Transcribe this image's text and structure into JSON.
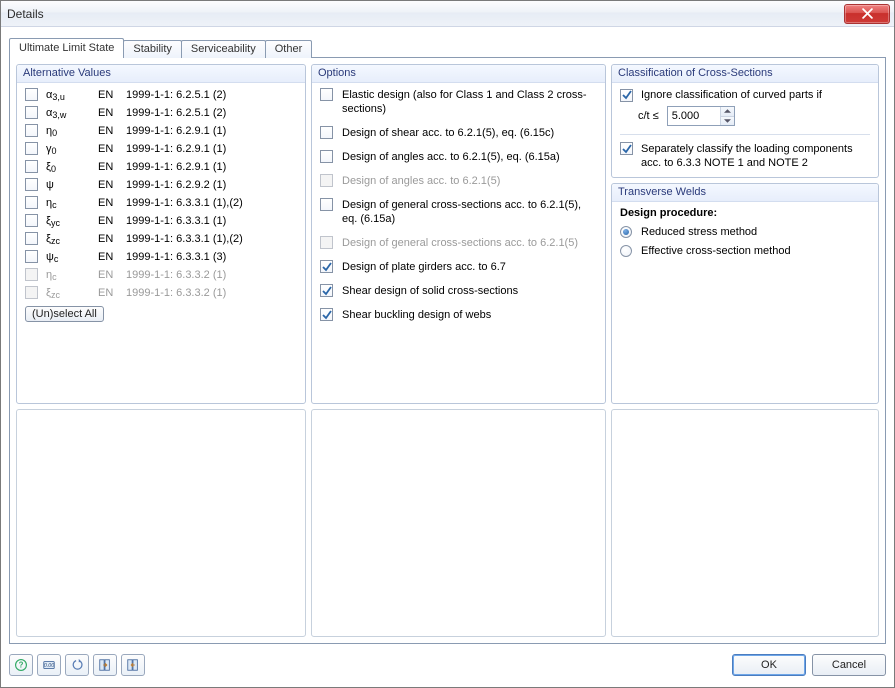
{
  "window": {
    "title": "Details"
  },
  "tabs": [
    "Ultimate Limit State",
    "Stability",
    "Serviceability",
    "Other"
  ],
  "active_tab": 0,
  "alt": {
    "title": "Alternative Values",
    "unselect": "(Un)select All",
    "rows": [
      {
        "checked": false,
        "enabled": true,
        "sym": "α",
        "sub": "3,u",
        "code": "EN",
        "ref": "1999-1-1: 6.2.5.1 (2)"
      },
      {
        "checked": false,
        "enabled": true,
        "sym": "α",
        "sub": "3,w",
        "code": "EN",
        "ref": "1999-1-1: 6.2.5.1 (2)"
      },
      {
        "checked": false,
        "enabled": true,
        "sym": "η",
        "sub": "0",
        "code": "EN",
        "ref": "1999-1-1: 6.2.9.1 (1)"
      },
      {
        "checked": false,
        "enabled": true,
        "sym": "γ",
        "sub": "0",
        "code": "EN",
        "ref": "1999-1-1: 6.2.9.1 (1)"
      },
      {
        "checked": false,
        "enabled": true,
        "sym": "ξ",
        "sub": "0",
        "code": "EN",
        "ref": "1999-1-1: 6.2.9.1 (1)"
      },
      {
        "checked": false,
        "enabled": true,
        "sym": "ψ",
        "sub": "",
        "code": "EN",
        "ref": "1999-1-1: 6.2.9.2 (1)"
      },
      {
        "checked": false,
        "enabled": true,
        "sym": "η",
        "sub": "c",
        "code": "EN",
        "ref": "1999-1-1: 6.3.3.1 (1),(2)"
      },
      {
        "checked": false,
        "enabled": true,
        "sym": "ξ",
        "sub": "yc",
        "code": "EN",
        "ref": "1999-1-1: 6.3.3.1 (1)"
      },
      {
        "checked": false,
        "enabled": true,
        "sym": "ξ",
        "sub": "zc",
        "code": "EN",
        "ref": "1999-1-1: 6.3.3.1 (1),(2)"
      },
      {
        "checked": false,
        "enabled": true,
        "sym": "ψ",
        "sub": "c",
        "code": "EN",
        "ref": "1999-1-1: 6.3.3.1 (3)"
      },
      {
        "checked": false,
        "enabled": false,
        "sym": "η",
        "sub": "c",
        "code": "EN",
        "ref": "1999-1-1: 6.3.3.2 (1)"
      },
      {
        "checked": false,
        "enabled": false,
        "sym": "ξ",
        "sub": "zc",
        "code": "EN",
        "ref": "1999-1-1: 6.3.3.2 (1)"
      }
    ]
  },
  "options": {
    "title": "Options",
    "items": [
      {
        "checked": false,
        "enabled": true,
        "label": "Elastic design (also for Class 1 and Class 2 cross-sections)"
      },
      {
        "checked": false,
        "enabled": true,
        "label": "Design of shear acc. to 6.2.1(5), eq. (6.15c)"
      },
      {
        "checked": false,
        "enabled": true,
        "label": "Design of angles acc. to 6.2.1(5), eq. (6.15a)"
      },
      {
        "checked": false,
        "enabled": false,
        "label": "Design of angles acc. to 6.2.1(5)"
      },
      {
        "checked": false,
        "enabled": true,
        "label": "Design of general cross-sections acc. to 6.2.1(5), eq. (6.15a)"
      },
      {
        "checked": false,
        "enabled": false,
        "label": "Design of general cross-sections acc. to 6.2.1(5)"
      },
      {
        "checked": true,
        "enabled": true,
        "label": "Design of plate girders acc. to 6.7"
      },
      {
        "checked": true,
        "enabled": true,
        "label": "Shear design of solid cross-sections"
      },
      {
        "checked": true,
        "enabled": true,
        "label": "Shear buckling design of webs"
      }
    ]
  },
  "classification": {
    "title": "Classification of Cross-Sections",
    "ignore": {
      "checked": true,
      "label": "Ignore classification of curved parts if"
    },
    "ct_label": "c/t ≤",
    "ct_value": "5.000",
    "separate": {
      "checked": true,
      "label": "Separately classify the loading components acc. to 6.3.3 NOTE 1 and NOTE 2"
    }
  },
  "welds": {
    "title": "Transverse Welds",
    "procedure_label": "Design procedure:",
    "reduced": "Reduced stress method",
    "effective": "Effective cross-section method",
    "selected": "reduced"
  },
  "footer": {
    "ok": "OK",
    "cancel": "Cancel"
  }
}
